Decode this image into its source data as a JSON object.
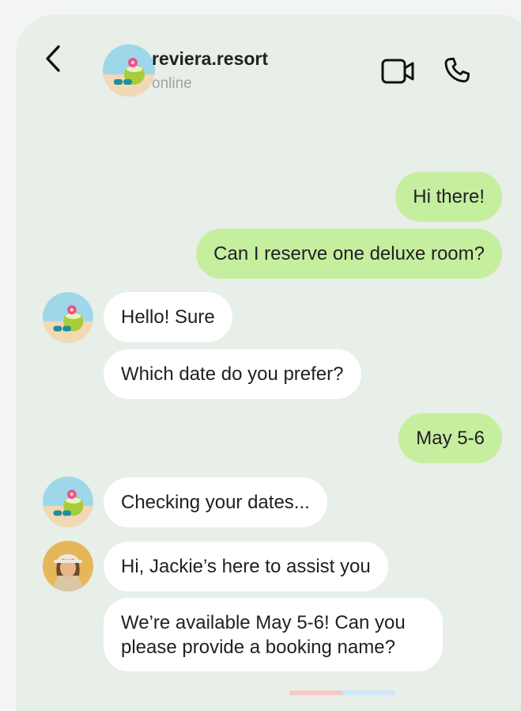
{
  "header": {
    "contact_name": "reviera.resort",
    "status": "online",
    "icons": {
      "back": "chevron-left-icon",
      "video": "video-camera-icon",
      "call": "phone-icon"
    }
  },
  "messages": [
    {
      "direction": "outgoing",
      "text": "Hi there!"
    },
    {
      "direction": "outgoing",
      "text": "Can I reserve one deluxe room?"
    },
    {
      "direction": "incoming",
      "sender": "reviera.resort",
      "text": "Hello! Sure"
    },
    {
      "direction": "incoming",
      "sender": "reviera.resort",
      "text": "Which date do you prefer?"
    },
    {
      "direction": "outgoing",
      "text": "May 5-6"
    },
    {
      "direction": "incoming",
      "sender": "reviera.resort",
      "text": "Checking your dates..."
    },
    {
      "direction": "incoming",
      "sender": "Jackie",
      "text": "Hi, Jackie’s here to assist you"
    },
    {
      "direction": "incoming",
      "sender": "Jackie",
      "text": "We’re available May 5-6! Can you please provide a booking name?"
    }
  ],
  "colors": {
    "background": "#e8eee8",
    "outgoing_bubble": "#c6ee9f",
    "incoming_bubble": "#ffffff",
    "text": "#202124",
    "status_text": "#a0a3a6"
  }
}
